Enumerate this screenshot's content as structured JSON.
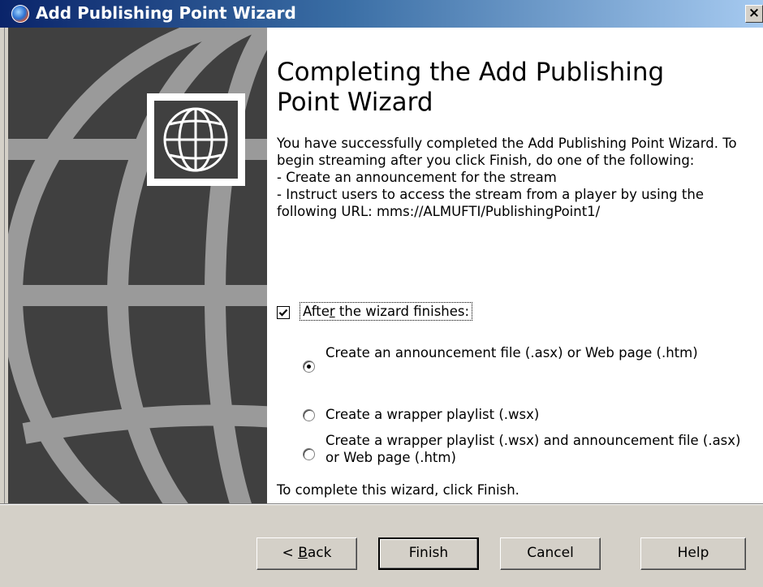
{
  "window": {
    "title": "Add Publishing Point Wizard",
    "close_glyph": "×"
  },
  "icons": {
    "title_icon": "windows-media-icon",
    "banner_graphic": "globe-icon",
    "logo": "globe-icon"
  },
  "page": {
    "heading": "Completing the Add Publishing Point Wizard",
    "intro": "You have successfully completed the Add Publishing Point Wizard. To begin streaming after you click Finish, do one of the following:\n- Create an announcement for the stream\n- Instruct users to access the stream from a player by using the following URL: mms://ALMUFTI/PublishingPoint1/",
    "after_finish": {
      "label_prefix": "Afte",
      "label_accel": "r",
      "label_suffix": " the wizard finishes:",
      "checked": true
    },
    "options": [
      {
        "label": "Create an announcement file (.asx) or Web page (.htm)",
        "selected": true
      },
      {
        "label": "Create a wrapper playlist (.wsx)",
        "selected": false
      },
      {
        "label": "Create a wrapper playlist (.wsx) and announcement file (.asx) or Web page (.htm)",
        "selected": false
      }
    ],
    "footer_note": "To complete this wizard, click Finish."
  },
  "buttons": {
    "back_prefix": "< ",
    "back_accel": "B",
    "back_suffix": "ack",
    "finish": "Finish",
    "cancel": "Cancel",
    "help": "Help"
  },
  "colors": {
    "title_bar_start": "#0a246a",
    "title_bar_end": "#a6caf0",
    "banner_bg": "#404040",
    "dialog_face": "#d4d0c8"
  }
}
